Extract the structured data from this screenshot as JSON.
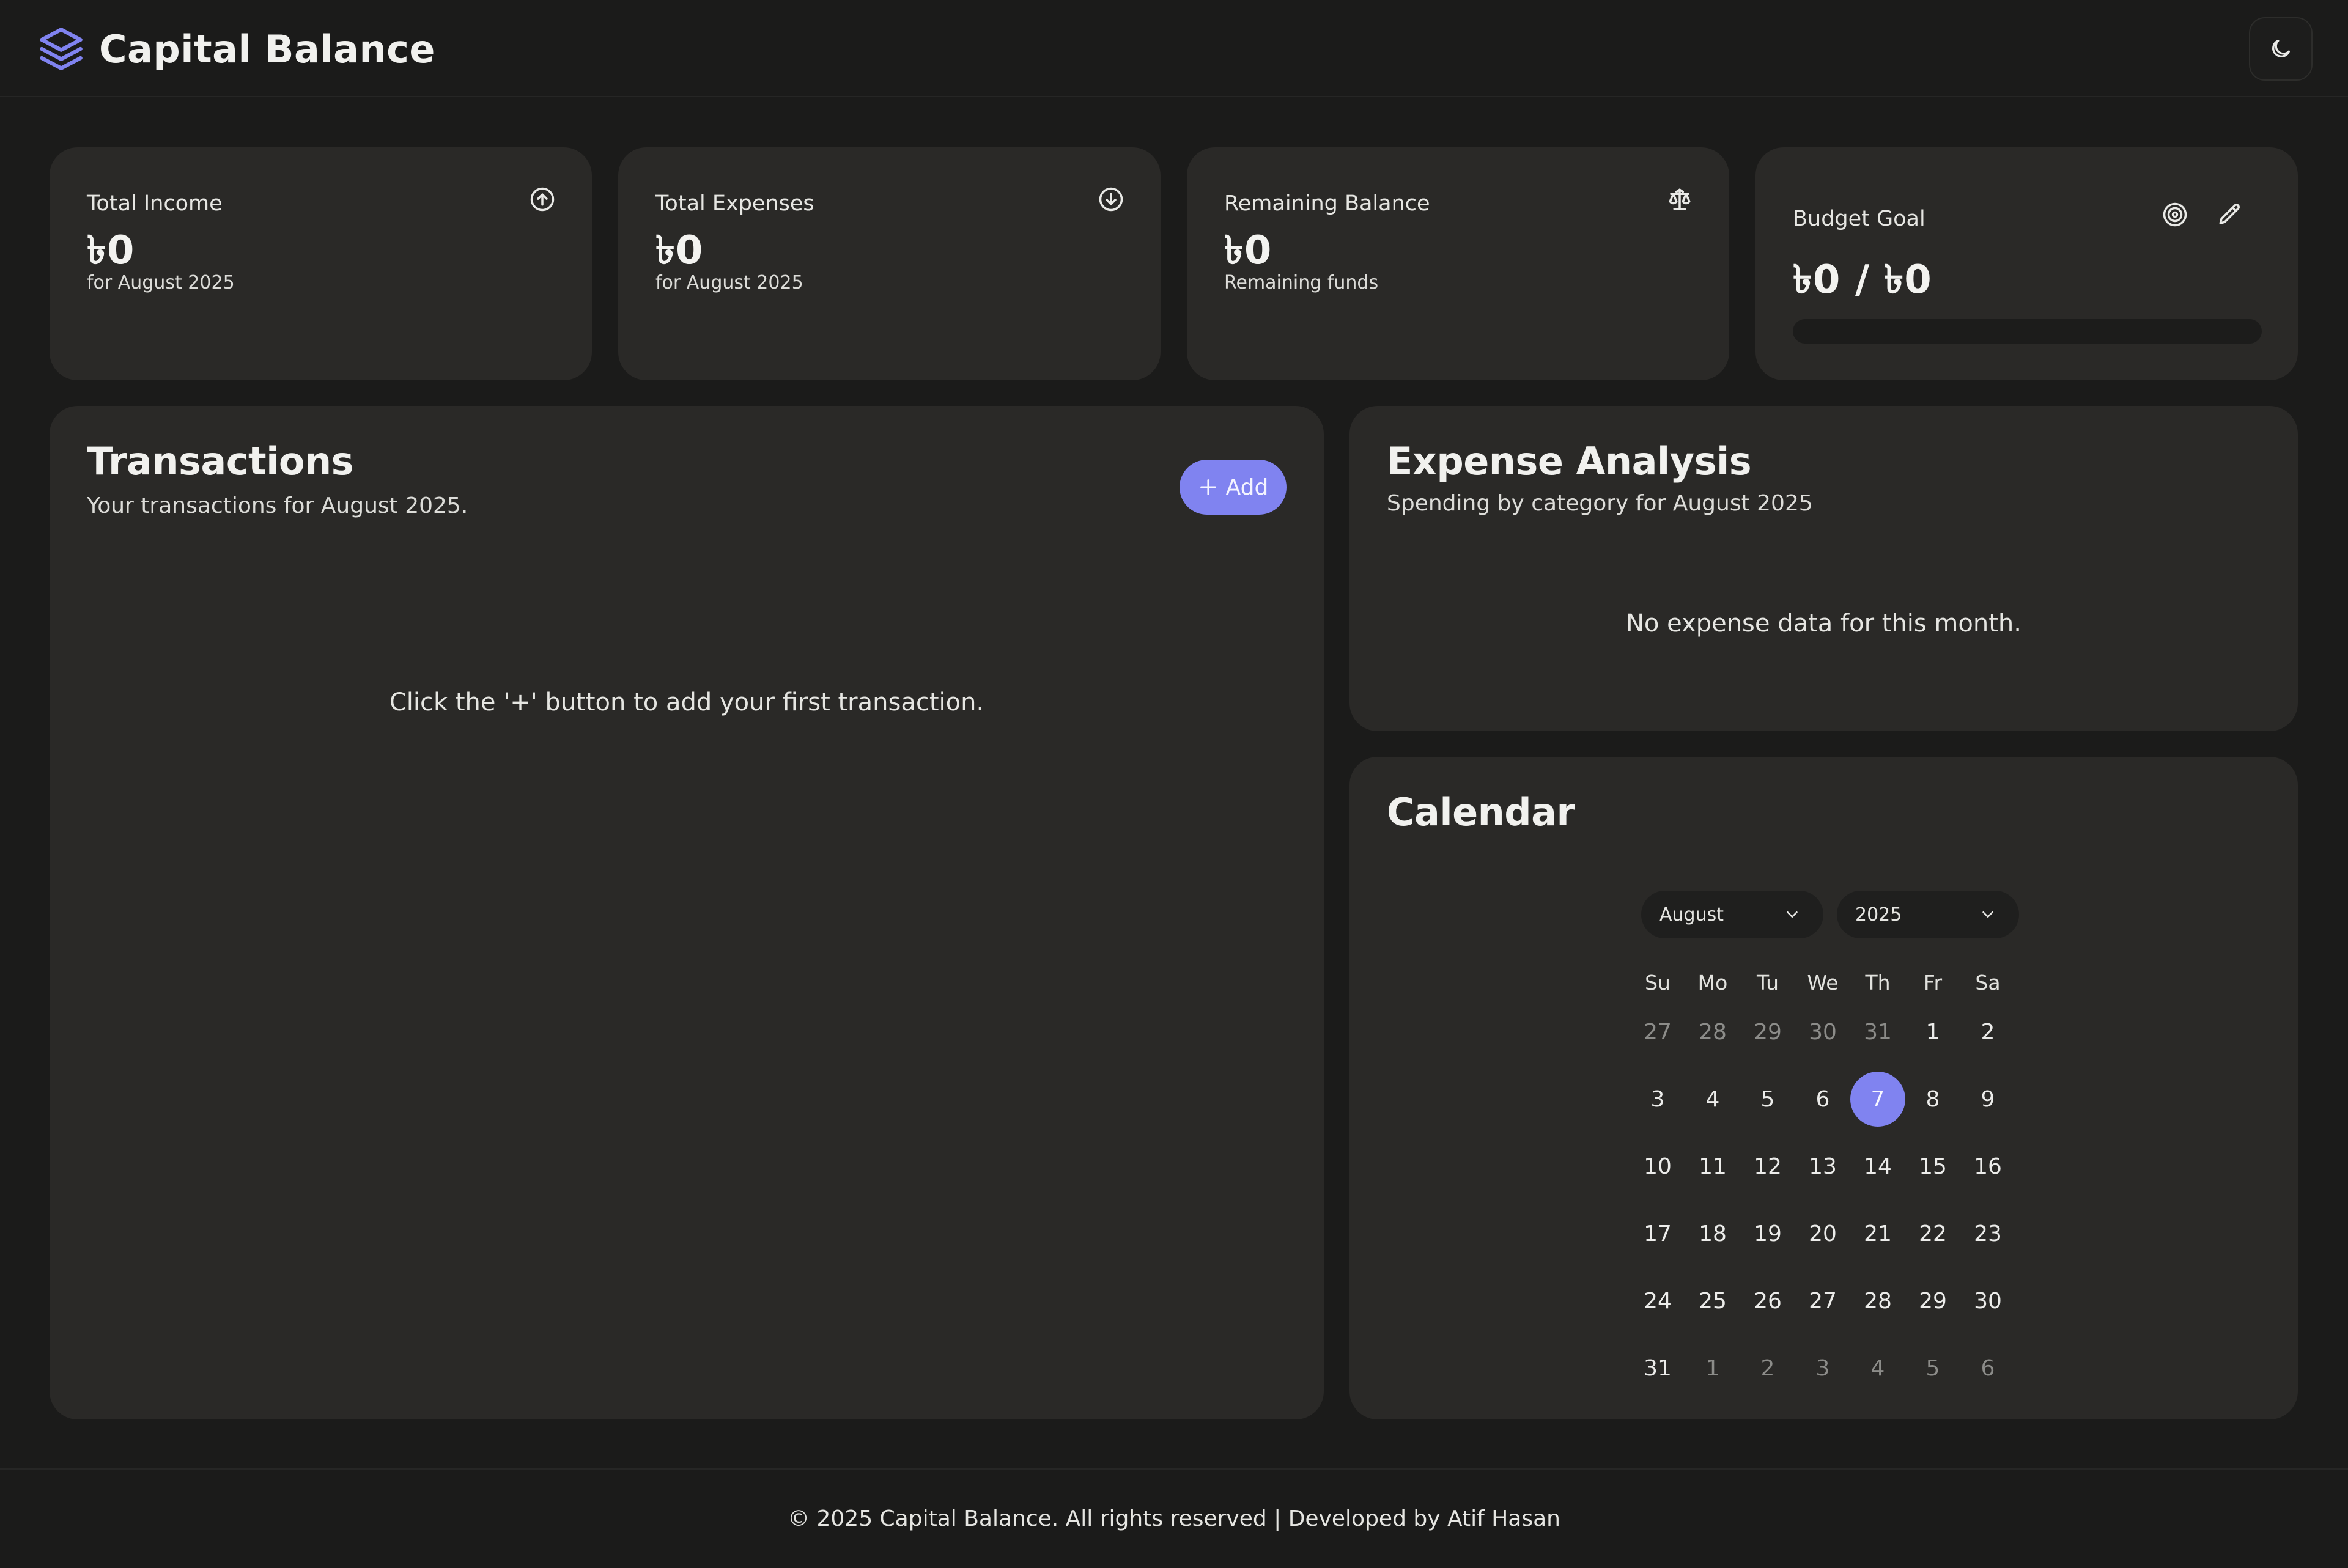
{
  "app": {
    "title": "Capital Balance",
    "logo_icon": "layers-icon",
    "theme_toggle_icon": "moon-icon"
  },
  "colors": {
    "background": "#1b1b1a",
    "card": "#2a2927",
    "accent": "#8083f0",
    "text": "#e9e9e6",
    "muted_text": "#8c8c89"
  },
  "stats": [
    {
      "label": "Total Income",
      "value": "৳0",
      "sub": "for August 2025",
      "icon": "arrow-up-circle-icon"
    },
    {
      "label": "Total Expenses",
      "value": "৳0",
      "sub": "for August 2025",
      "icon": "arrow-down-circle-icon"
    },
    {
      "label": "Remaining Balance",
      "value": "৳0",
      "sub": "Remaining funds",
      "icon": "scale-icon"
    }
  ],
  "budget": {
    "label": "Budget Goal",
    "value": "৳0 / ৳0",
    "progress": 0,
    "target_icon": "target-icon",
    "edit_icon": "pencil-icon"
  },
  "transactions": {
    "title": "Transactions",
    "subtitle": "Your transactions for August 2025.",
    "add_label": "Add",
    "add_icon": "plus-icon",
    "empty_message": "Click the '+' button to add your first transaction."
  },
  "expense_analysis": {
    "title": "Expense Analysis",
    "subtitle": "Spending by category for August 2025",
    "empty_message": "No expense data for this month."
  },
  "calendar": {
    "title": "Calendar",
    "month": "August",
    "year": "2025",
    "dropdown_icon": "chevron-down-icon",
    "weekdays": [
      "Su",
      "Mo",
      "Tu",
      "We",
      "Th",
      "Fr",
      "Sa"
    ],
    "weeks": [
      [
        "27",
        "28",
        "29",
        "30",
        "31",
        "1",
        "2"
      ],
      [
        "3",
        "4",
        "5",
        "6",
        "7",
        "8",
        "9"
      ],
      [
        "10",
        "11",
        "12",
        "13",
        "14",
        "15",
        "16"
      ],
      [
        "17",
        "18",
        "19",
        "20",
        "21",
        "22",
        "23"
      ],
      [
        "24",
        "25",
        "26",
        "27",
        "28",
        "29",
        "30"
      ],
      [
        "31",
        "1",
        "2",
        "3",
        "4",
        "5",
        "6"
      ]
    ],
    "outside_month": [
      [
        0,
        0
      ],
      [
        0,
        1
      ],
      [
        0,
        2
      ],
      [
        0,
        3
      ],
      [
        0,
        4
      ],
      [
        5,
        1
      ],
      [
        5,
        2
      ],
      [
        5,
        3
      ],
      [
        5,
        4
      ],
      [
        5,
        5
      ],
      [
        5,
        6
      ]
    ],
    "selected": [
      1,
      4
    ]
  },
  "footer": {
    "text": "© 2025 Capital Balance. All rights reserved | Developed by Atif Hasan"
  }
}
